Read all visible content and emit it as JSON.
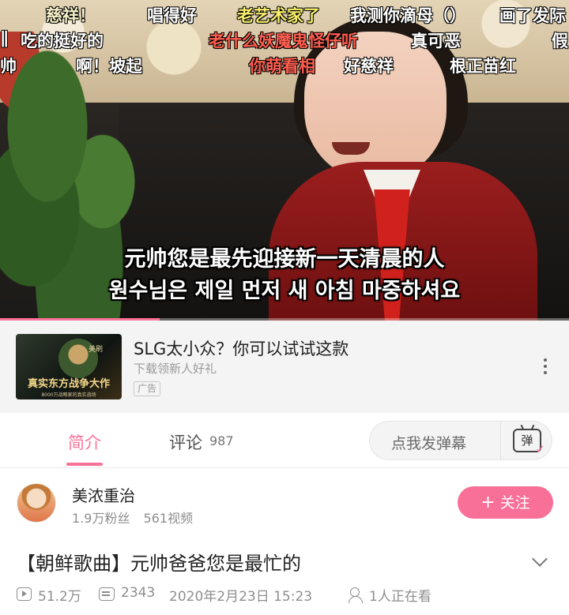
{
  "video": {
    "danmaku": [
      {
        "text": "慈祥！",
        "color": "#f4f1c8"
      },
      {
        "text": "唱得好",
        "color": "#ffffff"
      },
      {
        "text": "老艺术家了",
        "color": "#f7ee6b"
      },
      {
        "text": "我测你滴母（）",
        "color": "#ffffff"
      },
      {
        "text": "画了发际",
        "color": "#ffffff"
      },
      {
        "text": "吃的挺好的",
        "color": "#ffffff"
      },
      {
        "text": "老什么妖魔鬼怪仔听",
        "color": "#ff5d4f"
      },
      {
        "text": "真可恶",
        "color": "#ffffff"
      },
      {
        "text": "假",
        "color": "#ffffff"
      },
      {
        "text": "啊！坡起",
        "color": "#ffffff"
      },
      {
        "text": "你萌看相",
        "color": "#ff5d4f"
      },
      {
        "text": "好慈祥",
        "color": "#ffffff"
      },
      {
        "text": "根正苗红",
        "color": "#ffffff"
      },
      {
        "text": "帅",
        "color": "#ffffff"
      },
      {
        "text": "∥",
        "color": "#ffffff"
      }
    ],
    "subtitle_cn": "元帅您是最先迎接新一天清晨的人",
    "subtitle_kr": "원수님은 제일 먼저 새 아침 마중하셔요",
    "progress": 0.28
  },
  "ad": {
    "title": "SLG太小众？你可以试试这款",
    "subtitle": "下载领新人好礼",
    "badge": "广告",
    "thumb_caption": "真实东方战争大作",
    "thumb_sub": "8000万战略家的真实战场",
    "thumb_tag": "美刷"
  },
  "tabs": {
    "intro": "简介",
    "comments": "评论",
    "comments_count": "987",
    "danmaku_placeholder": "点我发弹幕",
    "danmaku_icon_text": "弹"
  },
  "uploader": {
    "name": "美浓重治",
    "followers": "1.9万粉丝",
    "videos": "561视频",
    "follow_label": "关注"
  },
  "title": "【朝鲜歌曲】元帅爸爸您是最忙的",
  "meta": {
    "views": "51.2万",
    "danmaku_count": "2343",
    "date": "2020年2月23日 15:23",
    "watching": "1人正在看"
  },
  "colors": {
    "accent": "#fb7299"
  }
}
